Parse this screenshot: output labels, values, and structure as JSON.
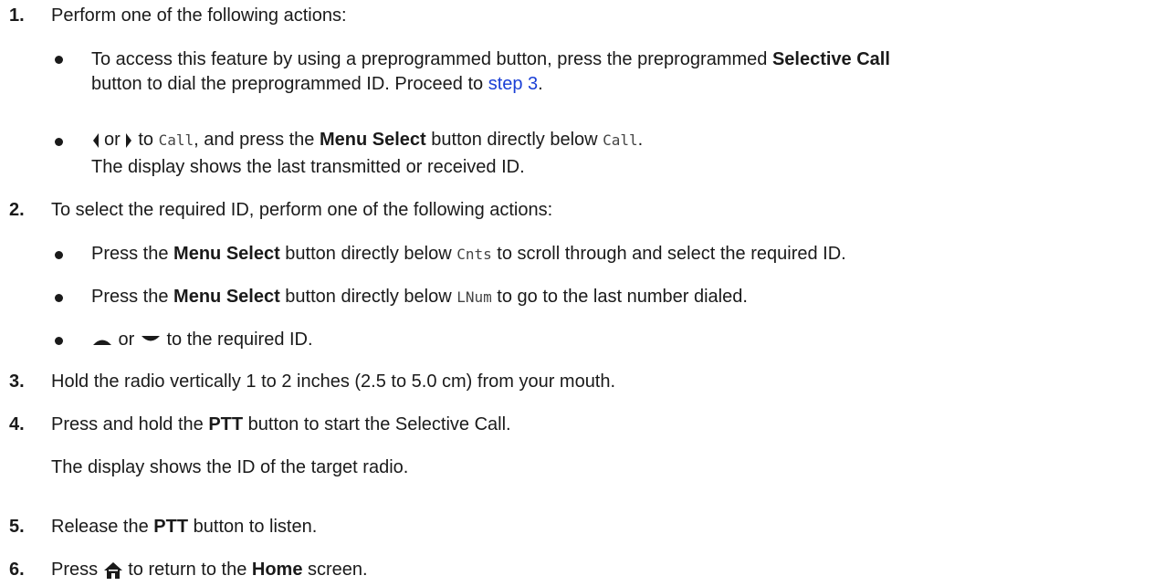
{
  "steps": [
    {
      "num": "1.",
      "text": "Perform one of the following actions:"
    },
    {
      "num": "2.",
      "text": "To select the required ID, perform one of the following actions:"
    },
    {
      "num": "3.",
      "text": "Hold the radio vertically 1 to 2 inches (2.5 to 5.0 cm) from your mouth."
    },
    {
      "num": "4.",
      "pre": "Press and hold the ",
      "bold": "PTT",
      "post": " button to start the Selective Call.",
      "note": "The display shows the ID of the target radio."
    },
    {
      "num": "5.",
      "pre": "Release the ",
      "bold": "PTT",
      "post": " button to listen."
    },
    {
      "num": "6.",
      "pre": "Press ",
      "post": " to return to the ",
      "bold": "Home",
      "post2": " screen."
    }
  ],
  "step1": {
    "a": {
      "pre": "To access this feature by using a preprogrammed button, press the preprogrammed ",
      "bold": "Selective Call",
      "line2_pre": "button to dial the preprogrammed ID. Proceed to ",
      "link": "step 3",
      "line2_post": "."
    },
    "b": {
      "or": "or",
      "to": " to ",
      "code1": "Call",
      "mid": ", and press the ",
      "bold": "Menu Select",
      "post": " button directly below ",
      "code2": "Call",
      "end": ".",
      "note": "The display shows the last transmitted or received ID."
    }
  },
  "step2": {
    "a": {
      "pre": "Press the ",
      "bold": "Menu Select",
      "mid": " button directly below ",
      "code": "Cnts",
      "post": " to scroll through and select the required ID."
    },
    "b": {
      "pre": "Press the ",
      "bold": "Menu Select",
      "mid": " button directly below ",
      "code": "LNum",
      "post": " to go to the last number dialed."
    },
    "c": {
      "or": " or ",
      "post": " to the required ID."
    }
  },
  "icons": [
    "left-arrow-icon",
    "right-arrow-icon",
    "up-arrow-icon",
    "down-arrow-icon",
    "home-icon"
  ]
}
